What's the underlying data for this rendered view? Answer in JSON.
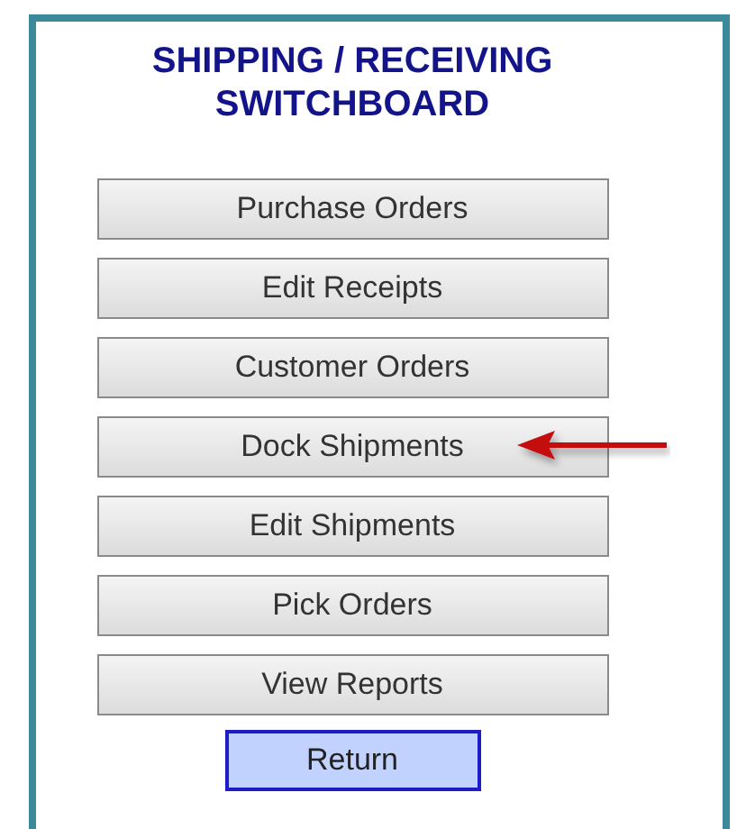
{
  "title": "SHIPPING / RECEIVING SWITCHBOARD",
  "buttons": [
    {
      "label": "Purchase Orders",
      "kind": "menu",
      "marked": false
    },
    {
      "label": "Edit Receipts",
      "kind": "menu",
      "marked": false
    },
    {
      "label": "Customer Orders",
      "kind": "menu",
      "marked": false
    },
    {
      "label": "Dock Shipments",
      "kind": "menu",
      "marked": true
    },
    {
      "label": "Edit Shipments",
      "kind": "menu",
      "marked": false
    },
    {
      "label": "Pick Orders",
      "kind": "menu",
      "marked": false
    },
    {
      "label": "View Reports",
      "kind": "menu",
      "marked": false
    },
    {
      "label": "Return",
      "kind": "return",
      "marked": false
    }
  ]
}
